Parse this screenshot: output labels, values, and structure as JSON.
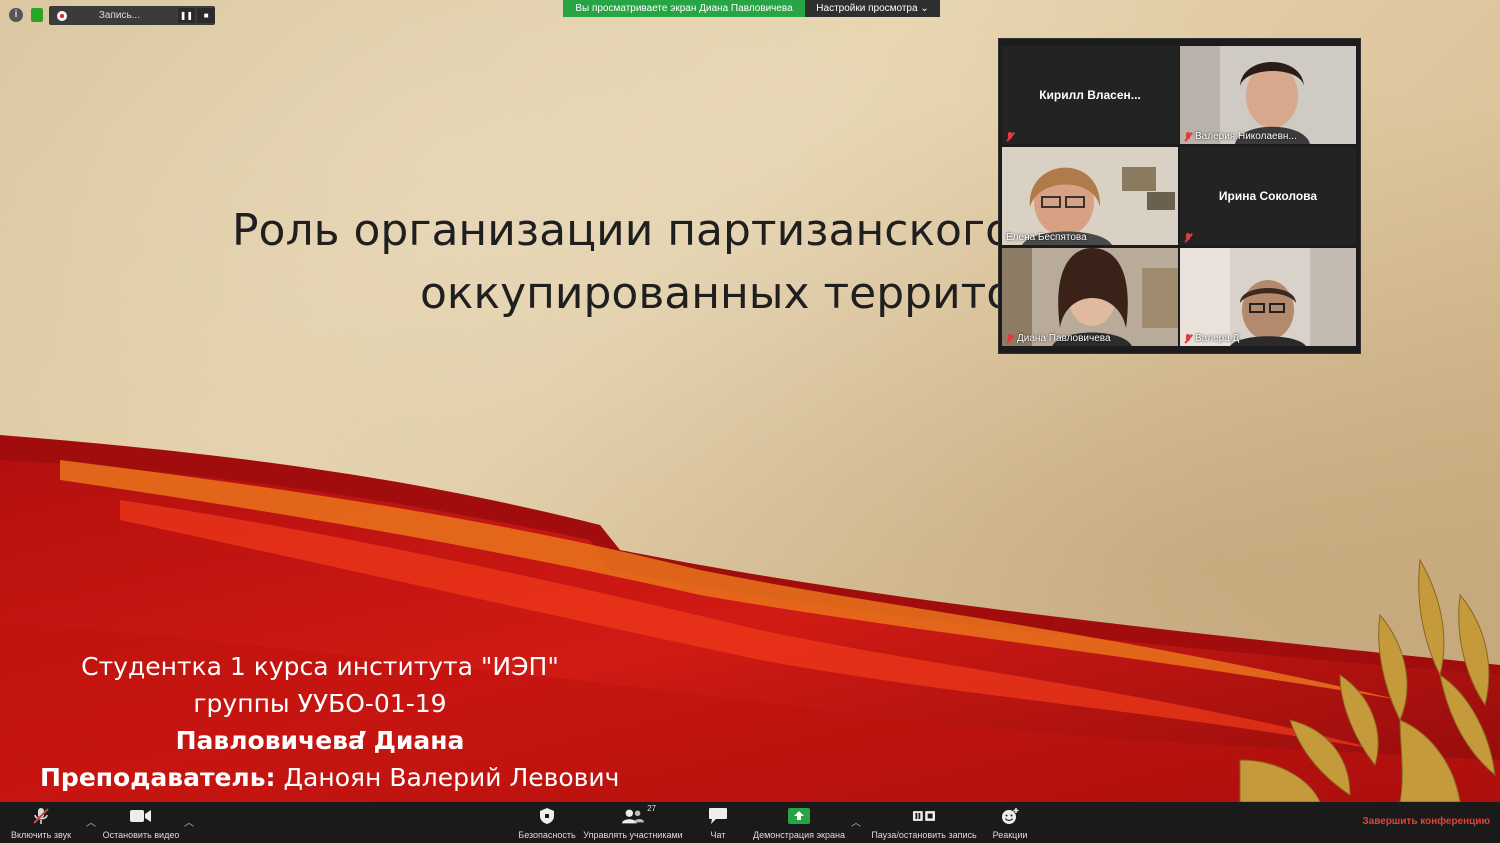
{
  "top": {
    "recording_label": "Запись...",
    "share_banner": "Вы просматриваете экран Диана Павловичева",
    "view_options": "Настройки просмотра ⌄",
    "info_icon": "info-icon",
    "lock_icon": "lock-icon"
  },
  "slide": {
    "title_line1": "Роль организации партизанского",
    "title_line2": "оккупированных террито",
    "credit_line1": "Студентка 1 курса института \"ИЭП\"",
    "credit_line2": "группы УУБО-01-19",
    "credit_line3": "Павловичева Диана",
    "teacher_label": "Преподаватель:",
    "teacher_name": " Даноян Валерий Левович"
  },
  "gallery": {
    "participants": [
      {
        "name": "Кирилл  Власен...",
        "label": "",
        "video": false,
        "muted": true
      },
      {
        "name": "",
        "label": "Валерия Николаевн...",
        "video": true,
        "muted": true
      },
      {
        "name": "",
        "label": "Елена Беспятова",
        "video": true,
        "muted": false,
        "active": true
      },
      {
        "name": "Ирина Соколова",
        "label": "",
        "video": false,
        "muted": true
      },
      {
        "name": "",
        "label": "Диана Павловичева",
        "video": true,
        "muted": true
      },
      {
        "name": "",
        "label": "Валера Д",
        "video": true,
        "muted": true
      }
    ]
  },
  "toolbar": {
    "unmute": "Включить звук",
    "stop_video": "Остановить видео",
    "security": "Безопасность",
    "participants": "Управлять участниками",
    "participants_count": "27",
    "chat": "Чат",
    "share": "Демонстрация экрана",
    "pause_record": "Пауза/остановить запись",
    "reactions": "Реакции",
    "end": "Завершить конференцию"
  },
  "colors": {
    "share_green": "#27a444",
    "end_red": "#e2413a",
    "active_speaker": "#c9d12a"
  }
}
